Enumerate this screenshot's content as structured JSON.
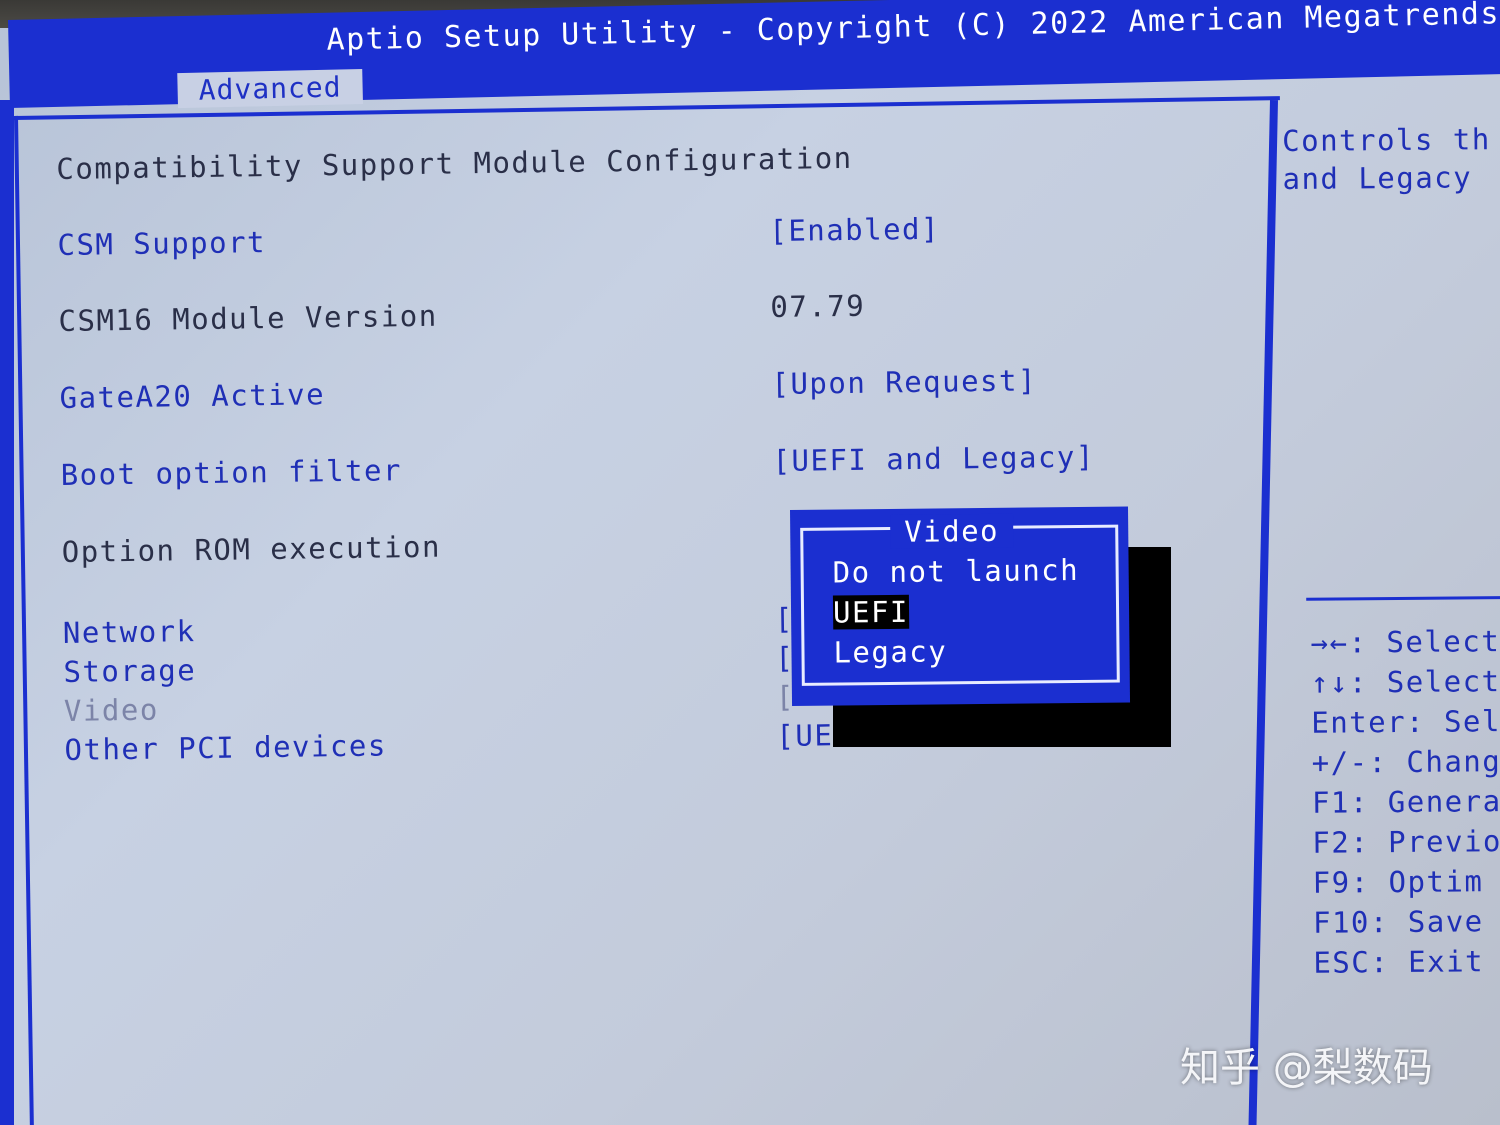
{
  "header": {
    "title": "Aptio Setup Utility - Copyright (C) 2022 American Megatrends,",
    "active_tab": "Advanced"
  },
  "main": {
    "section_title": "Compatibility Support Module Configuration",
    "rows": [
      {
        "label": "CSM Support",
        "value": "[Enabled]"
      },
      {
        "label": "CSM16 Module Version",
        "value": "07.79"
      },
      {
        "label": "GateA20 Active",
        "value": "[Upon Request]"
      },
      {
        "label": "Boot option filter",
        "value": "[UEFI and Legacy]"
      },
      {
        "label": "Option ROM execution",
        "value": ""
      },
      {
        "label": "Network",
        "value": "["
      },
      {
        "label": "Storage",
        "value": "["
      },
      {
        "label": "Video",
        "value": "["
      },
      {
        "label": "Other PCI devices",
        "value": "[UE"
      }
    ]
  },
  "popup": {
    "title": "Video",
    "options": [
      "Do not launch",
      "UEFI",
      "Legacy"
    ],
    "selected_index": 1
  },
  "help": {
    "description_lines": [
      "Controls th",
      "and Legacy"
    ],
    "keys": [
      "→←: Select",
      "↑↓: Select",
      "Enter: Sel",
      "+/-: Chang",
      "F1: Genera",
      "F2: Previo",
      "F9: Optim",
      "F10: Save",
      "ESC: Exit"
    ]
  },
  "watermark": "知乎 @梨数码",
  "colors": {
    "bios_blue": "#1b2fd0",
    "background": "#c3cbdb",
    "item_text_blue": "#1f2fb6",
    "selection_bg": "#000000"
  }
}
